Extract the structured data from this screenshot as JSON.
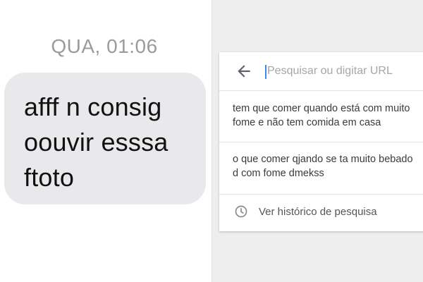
{
  "chat": {
    "timestamp": "QUA, 01:06",
    "message": "afff n consig\noouvir esssa\nftoto"
  },
  "browser": {
    "search": {
      "placeholder": "Pesquisar ou digitar URL",
      "value": ""
    },
    "suggestions": [
      {
        "text": "tem que comer quando está com muito\nfome e não tem comida em casa"
      },
      {
        "text": "o que comer qjando se ta muito bebado\nd com fome dmekss"
      }
    ],
    "history_label": "Ver histórico de pesquisa",
    "icons": {
      "back": "arrow-back-icon",
      "history": "clock-icon"
    },
    "colors": {
      "caret": "#4285f4"
    }
  }
}
